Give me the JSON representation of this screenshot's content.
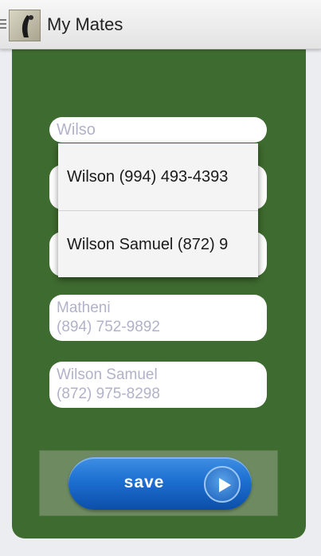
{
  "app": {
    "title": "My Mates",
    "logo_icon": "app-logo-icon",
    "menu_icon": "menu-icon"
  },
  "search": {
    "value": "Wilso"
  },
  "suggestions": [
    {
      "label": "Wilson (994) 493-4393"
    },
    {
      "label": "Wilson Samuel (872) 9"
    }
  ],
  "contacts": [
    {
      "name": "Matheni",
      "phone": "(894) 752-9892"
    },
    {
      "name": "Wilson Samuel",
      "phone": "(872) 975-8298"
    }
  ],
  "save_button": {
    "label": "save",
    "icon": "play-icon"
  },
  "colors": {
    "panel": "#3e6b2f",
    "placeholder_text": "#b1b1c9",
    "button_blue": "#1d6fd1"
  }
}
